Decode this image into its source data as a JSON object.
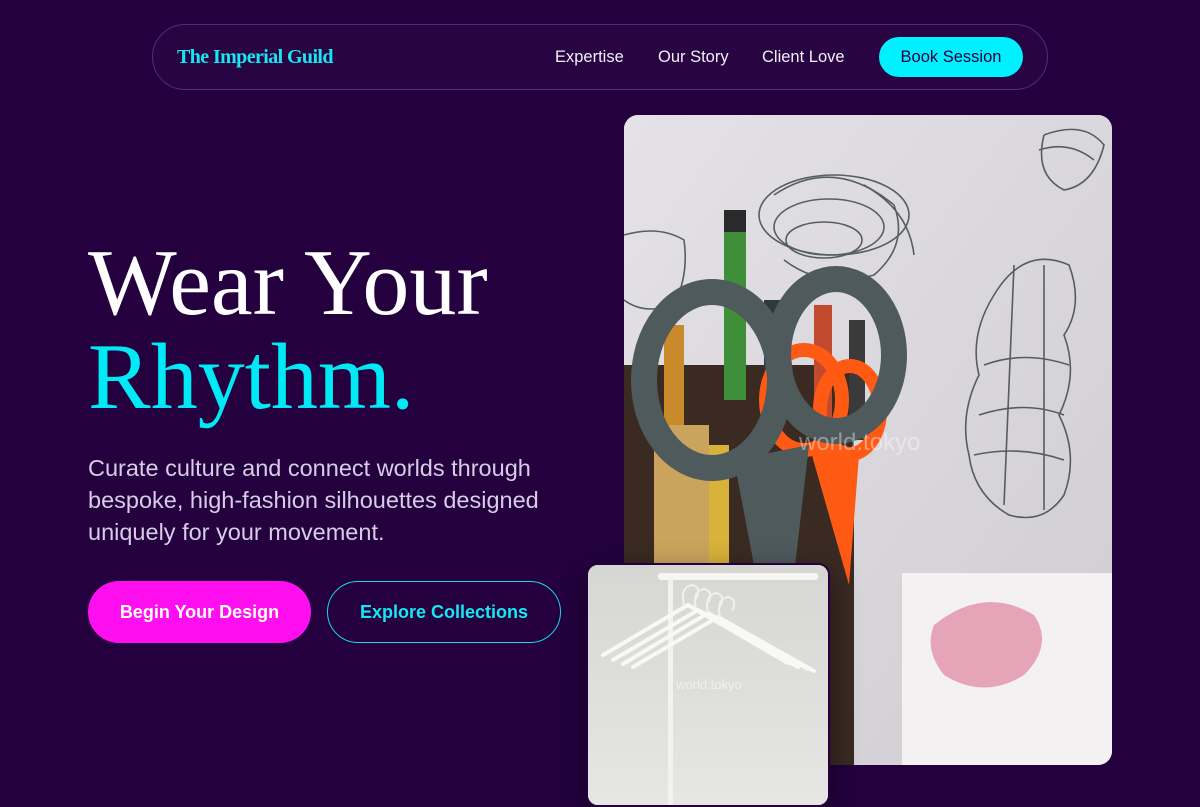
{
  "nav": {
    "brand": "The Imperial Guild",
    "links": [
      "Expertise",
      "Our Story",
      "Client Love"
    ],
    "cta": "Book Session"
  },
  "hero": {
    "headline_line1": "Wear Your",
    "headline_line2": "Rhythm.",
    "subtitle": "Curate culture and connect worlds through bespoke, high-fashion silhouettes designed uniquely for your movement.",
    "primary_cta": "Begin Your Design",
    "secondary_cta": "Explore Collections"
  },
  "images": {
    "main_watermark": "world.tokyo",
    "small_watermark": "world.tokyo"
  },
  "colors": {
    "background": "#24003f",
    "accent_cyan": "#00f0ff",
    "accent_magenta": "#ff0ef0"
  }
}
